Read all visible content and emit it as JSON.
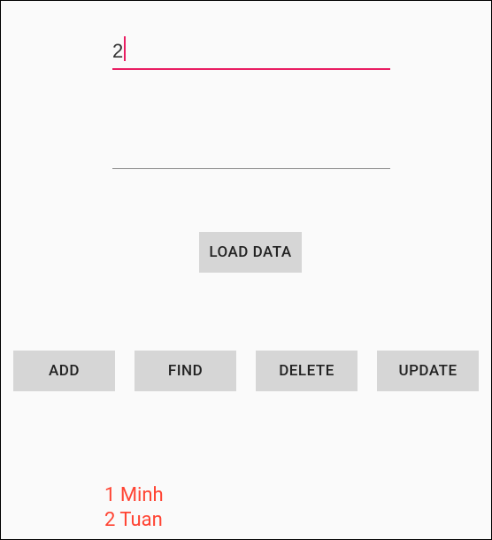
{
  "inputs": {
    "field1_value": "2",
    "field2_value": ""
  },
  "buttons": {
    "load_data": "LOAD DATA",
    "add": "ADD",
    "find": "FIND",
    "delete": "DELETE",
    "update": "UPDATE"
  },
  "results": {
    "items": [
      {
        "id": "1",
        "name": "Minh"
      },
      {
        "id": "2",
        "name": "Tuan"
      }
    ]
  }
}
